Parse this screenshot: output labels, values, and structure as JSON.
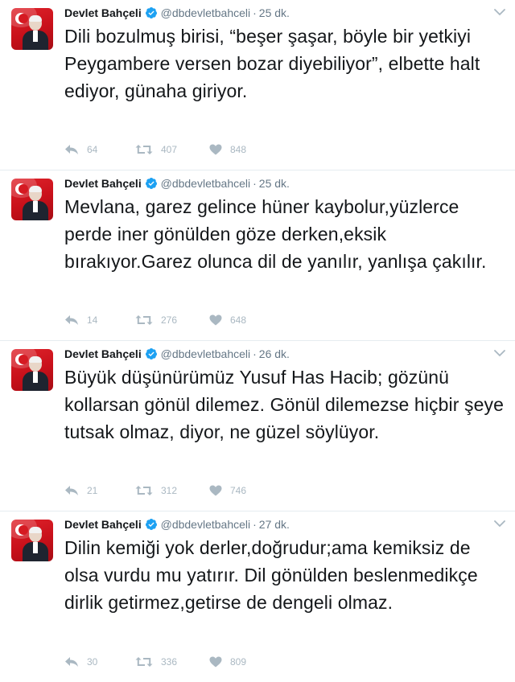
{
  "user": {
    "name": "Devlet Bahçeli",
    "handle": "@dbdevletbahceli"
  },
  "colors": {
    "verified": "#1da1f2",
    "text": "#14171a",
    "muted": "#657786",
    "icon": "#aab8c2"
  },
  "icons": {
    "reply": "reply-icon",
    "retweet": "retweet-icon",
    "like": "heart-icon",
    "verified": "verified-badge-icon",
    "caret": "chevron-down-icon"
  },
  "tweets": [
    {
      "time": "25 dk.",
      "text": "Dili bozulmuş birisi, “beşer şaşar, böyle bir yetkiyi Peygambere versen bozar diyebiliyor”, elbette halt ediyor, günaha giriyor.",
      "replies": "64",
      "retweets": "407",
      "likes": "848"
    },
    {
      "time": "25 dk.",
      "text": "Mevlana, garez gelince hüner kaybolur,yüzlerce perde iner gönülden göze derken,eksik bırakıyor.Garez olunca dil de yanılır, yanlışa çakılır.",
      "replies": "14",
      "retweets": "276",
      "likes": "648"
    },
    {
      "time": "26 dk.",
      "text": "Büyük düşünürümüz Yusuf Has Hacib; gözünü kollarsan gönül dilemez. Gönül dilemezse hiçbir şeye tutsak olmaz, diyor, ne güzel söylüyor.",
      "replies": "21",
      "retweets": "312",
      "likes": "746"
    },
    {
      "time": "27 dk.",
      "text": "Dilin kemiği yok derler,doğrudur;ama kemiksiz de olsa vurdu mu yatırır. Dil gönülden beslenmedikçe dirlik getirmez,getirse de dengeli olmaz.",
      "replies": "30",
      "retweets": "336",
      "likes": "809"
    }
  ]
}
